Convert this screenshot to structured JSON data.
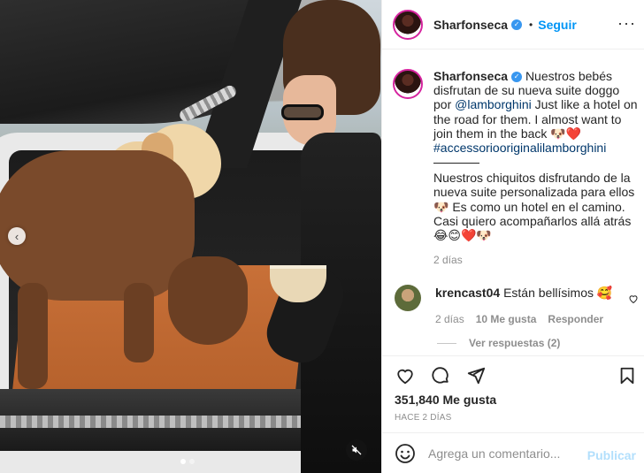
{
  "post": {
    "username": "Sharfonseca",
    "dot": "•",
    "follow_label": "Seguir",
    "more_icon": "more-horizontal-icon"
  },
  "caption": {
    "username": "Sharfonseca",
    "text_1": "Nuestros bebés disfrutan de su nueva suite doggo por ",
    "mention": "@lamborghini",
    "text_2": " Just like a hotel on the road for them. I almost want to join them in the back 🐶❤️",
    "hashtag": "#accessoriooriginalilamborghini",
    "text_es": "Nuestros chiquitos disfrutando de la nueva suite personalizada para ellos 🐶 Es como un hotel en el camino. Casi quiero acompañarlos allá atrás 😂😊❤️🐶",
    "time": "2 días"
  },
  "comment": {
    "username": "krencast04",
    "text": "Están bellísimos 🥰",
    "time": "2 días",
    "likes": "10 Me gusta",
    "reply": "Responder",
    "view_replies": "Ver respuestas (2)"
  },
  "actions": {
    "likes": "351,840 Me gusta",
    "date": "HACE 2 DÍAS"
  },
  "add_comment": {
    "placeholder": "Agrega un comentario...",
    "publish": "Publicar"
  },
  "colors": {
    "accent": "#0095f6",
    "verified": "#3897f0",
    "publish_disabled": "#b2dffc"
  }
}
